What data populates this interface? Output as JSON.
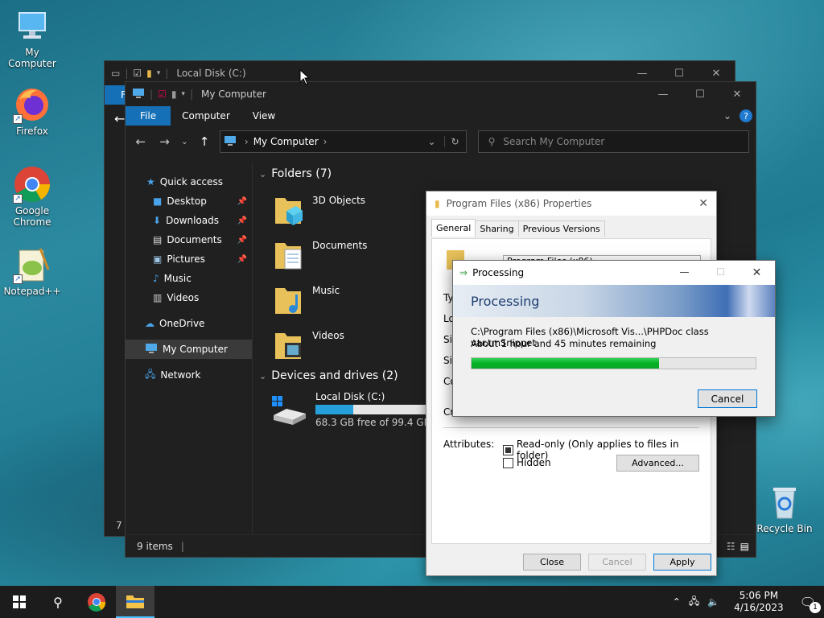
{
  "desktop": {
    "icons": [
      {
        "label": "My Computer"
      },
      {
        "label": "Firefox"
      },
      {
        "label": "Google Chrome"
      },
      {
        "label": "Notepad++"
      },
      {
        "label": "Recycle Bin"
      }
    ]
  },
  "back_window": {
    "title": "Local Disk (C:)",
    "ribbon_file_partial": "F",
    "status_partial": "7 i"
  },
  "explorer": {
    "title": "My Computer",
    "ribbon_tabs": [
      "File",
      "Computer",
      "View"
    ],
    "address": "My Computer",
    "search_placeholder": "Search My Computer",
    "sidebar": {
      "quick_access": "Quick access",
      "items": [
        {
          "label": "Desktop",
          "pinned": true
        },
        {
          "label": "Downloads",
          "pinned": true
        },
        {
          "label": "Documents",
          "pinned": true
        },
        {
          "label": "Pictures",
          "pinned": true
        },
        {
          "label": "Music",
          "pinned": false
        },
        {
          "label": "Videos",
          "pinned": false
        }
      ],
      "onedrive": "OneDrive",
      "my_computer": "My Computer",
      "network": "Network"
    },
    "folders_header": "Folders (7)",
    "folders": [
      "3D Objects",
      "Documents",
      "Music",
      "Videos"
    ],
    "devices_header": "Devices and drives (2)",
    "drive": {
      "name": "Local Disk (C:)",
      "free": "68.3 GB free of 99.4 GB",
      "used_fraction": 0.313
    },
    "status": "9 items"
  },
  "properties": {
    "title": "Program Files (x86) Properties",
    "tabs": [
      "General",
      "Sharing",
      "Previous Versions"
    ],
    "name_field": "Program Files (x86)",
    "row_labels_partial": [
      "Ty",
      "Lo",
      "Siz",
      "Siz",
      "Co",
      "Cr"
    ],
    "attributes_label": "Attributes:",
    "readonly_label": "Read-only (Only applies to files in folder)",
    "hidden_label": "Hidden",
    "advanced_button": "Advanced...",
    "close_button": "Close",
    "cancel_button": "Cancel",
    "apply_button": "Apply"
  },
  "processing": {
    "title": "Processing",
    "banner": "Processing",
    "path": "C:\\Program Files (x86)\\Microsoft Vis...\\PHPDoc class var.tmSnippet",
    "remaining": "About 1 hour and 45 minutes remaining",
    "progress_fraction": 0.66,
    "cancel_button": "Cancel"
  },
  "taskbar": {
    "time": "5:06 PM",
    "date": "4/16/2023",
    "notification_count": "1"
  },
  "colors": {
    "accent": "#1570b7",
    "progress_green": "#06b025",
    "drive_bar": "#26a0da"
  }
}
